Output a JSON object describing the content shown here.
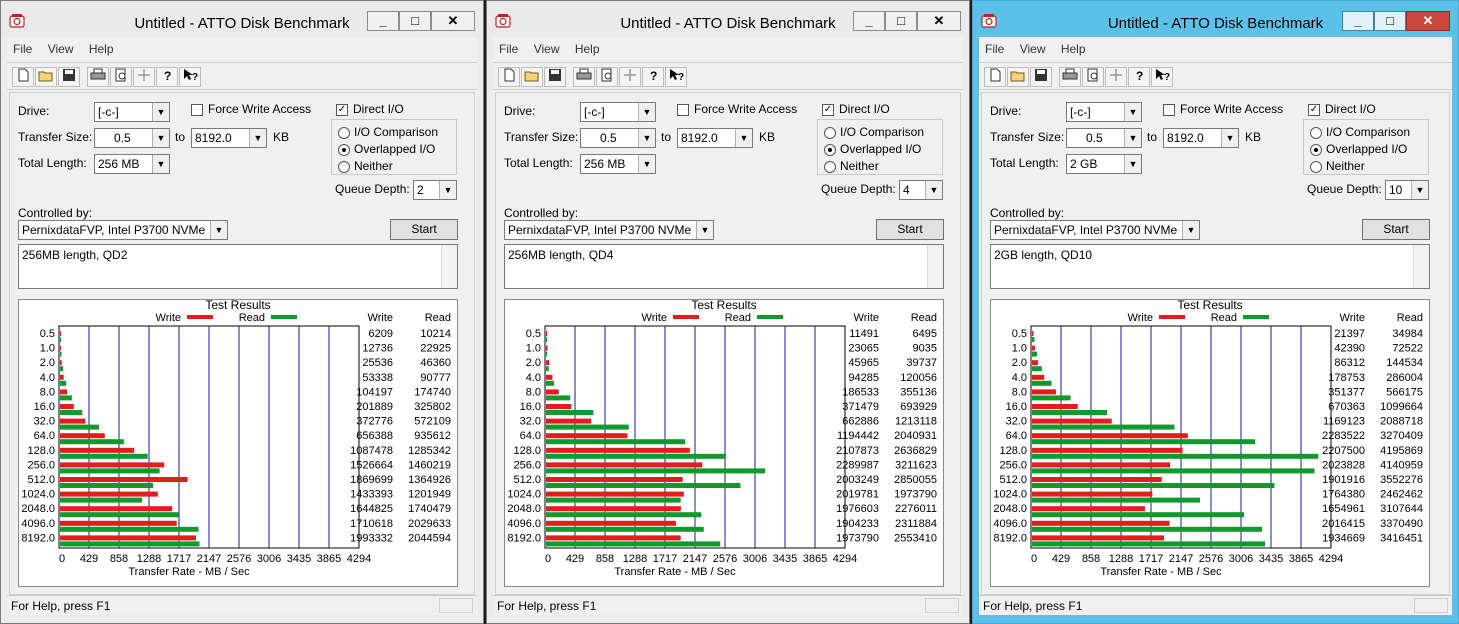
{
  "windows": [
    {
      "title": "Untitled - ATTO Disk Benchmark",
      "menu": [
        "File",
        "View",
        "Help"
      ],
      "drive_label": "Drive:",
      "drive": "[-c-]",
      "transfer_size_label": "Transfer Size:",
      "transfer_from": "0.5",
      "to_label": "to",
      "transfer_to": "8192.0",
      "kb_label": "KB",
      "total_length_label": "Total Length:",
      "total_length": "256 MB",
      "force_write_label": "Force Write Access",
      "direct_io_label": "Direct I/O",
      "direct_io_checked": true,
      "io_comparison_label": "I/O Comparison",
      "overlapped_io_label": "Overlapped I/O",
      "neither_label": "Neither",
      "queue_depth_label": "Queue Depth:",
      "queue_depth": "2",
      "controlled_by_label": "Controlled by:",
      "controlled_by": "PernixdataFVP, Intel P3700 NVMe",
      "start_label": "Start",
      "notes": "256MB length, QD2",
      "results_title": "Test Results",
      "legend_write": "Write",
      "legend_read": "Read",
      "col_write": "Write",
      "col_read": "Read",
      "status": "For Help, press F1",
      "chart_data": {
        "type": "bar",
        "xlabel": "Transfer Rate - MB / Sec",
        "xlim": [
          0,
          4294
        ],
        "xticks": [
          "0",
          "429",
          "858",
          "1288",
          "1717",
          "2147",
          "2576",
          "3006",
          "3435",
          "3865",
          "4294"
        ],
        "categories": [
          "0.5",
          "1.0",
          "2.0",
          "4.0",
          "8.0",
          "16.0",
          "32.0",
          "64.0",
          "128.0",
          "256.0",
          "512.0",
          "1024.0",
          "2048.0",
          "4096.0",
          "8192.0"
        ],
        "series": [
          {
            "name": "Write",
            "color": "#e51c1c",
            "values": [
              6209,
              12736,
              25536,
              53338,
              104197,
              201889,
              372776,
              656388,
              1087478,
              1526664,
              1869699,
              1433393,
              1644825,
              1710618,
              1993332
            ]
          },
          {
            "name": "Read",
            "color": "#119a2c",
            "values": [
              10214,
              22925,
              46360,
              90777,
              174740,
              325802,
              572109,
              935612,
              1285342,
              1460219,
              1364926,
              1201949,
              1740479,
              2029633,
              2044594
            ]
          }
        ]
      }
    },
    {
      "title": "Untitled - ATTO Disk Benchmark",
      "menu": [
        "File",
        "View",
        "Help"
      ],
      "drive_label": "Drive:",
      "drive": "[-c-]",
      "transfer_size_label": "Transfer Size:",
      "transfer_from": "0.5",
      "to_label": "to",
      "transfer_to": "8192.0",
      "kb_label": "KB",
      "total_length_label": "Total Length:",
      "total_length": "256 MB",
      "force_write_label": "Force Write Access",
      "direct_io_label": "Direct I/O",
      "direct_io_checked": true,
      "io_comparison_label": "I/O Comparison",
      "overlapped_io_label": "Overlapped I/O",
      "neither_label": "Neither",
      "queue_depth_label": "Queue Depth:",
      "queue_depth": "4",
      "controlled_by_label": "Controlled by:",
      "controlled_by": "PernixdataFVP, Intel P3700 NVMe",
      "start_label": "Start",
      "notes": "256MB length, QD4",
      "results_title": "Test Results",
      "legend_write": "Write",
      "legend_read": "Read",
      "col_write": "Write",
      "col_read": "Read",
      "status": "For Help, press F1",
      "chart_data": {
        "type": "bar",
        "xlabel": "Transfer Rate - MB / Sec",
        "xlim": [
          0,
          4294
        ],
        "xticks": [
          "0",
          "429",
          "858",
          "1288",
          "1717",
          "2147",
          "2576",
          "3006",
          "3435",
          "3865",
          "4294"
        ],
        "categories": [
          "0.5",
          "1.0",
          "2.0",
          "4.0",
          "8.0",
          "16.0",
          "32.0",
          "64.0",
          "128.0",
          "256.0",
          "512.0",
          "1024.0",
          "2048.0",
          "4096.0",
          "8192.0"
        ],
        "series": [
          {
            "name": "Write",
            "color": "#e51c1c",
            "values": [
              11491,
              23065,
              45965,
              94285,
              186533,
              371479,
              662886,
              1194442,
              2107873,
              2289987,
              2003249,
              2019781,
              1976603,
              1904233,
              1973790
            ]
          },
          {
            "name": "Read",
            "color": "#119a2c",
            "values": [
              6495,
              9035,
              39737,
              120056,
              355136,
              693929,
              1213118,
              2040931,
              2636829,
              3211623,
              2850055,
              1973790,
              2276011,
              2311884,
              2553410
            ]
          }
        ]
      }
    },
    {
      "title": "Untitled - ATTO Disk Benchmark",
      "menu": [
        "File",
        "View",
        "Help"
      ],
      "drive_label": "Drive:",
      "drive": "[-c-]",
      "transfer_size_label": "Transfer Size:",
      "transfer_from": "0.5",
      "to_label": "to",
      "transfer_to": "8192.0",
      "kb_label": "KB",
      "total_length_label": "Total Length:",
      "total_length": "2 GB",
      "force_write_label": "Force Write Access",
      "direct_io_label": "Direct I/O",
      "direct_io_checked": true,
      "io_comparison_label": "I/O Comparison",
      "overlapped_io_label": "Overlapped I/O",
      "neither_label": "Neither",
      "queue_depth_label": "Queue Depth:",
      "queue_depth": "10",
      "controlled_by_label": "Controlled by:",
      "controlled_by": "PernixdataFVP, Intel P3700 NVMe",
      "start_label": "Start",
      "notes": "2GB length, QD10",
      "results_title": "Test Results",
      "legend_write": "Write",
      "legend_read": "Read",
      "col_write": "Write",
      "col_read": "Read",
      "status": "For Help, press F1",
      "chart_data": {
        "type": "bar",
        "xlabel": "Transfer Rate - MB / Sec",
        "xlim": [
          0,
          4294
        ],
        "xticks": [
          "0",
          "429",
          "858",
          "1288",
          "1717",
          "2147",
          "2576",
          "3006",
          "3435",
          "3865",
          "4294"
        ],
        "categories": [
          "0.5",
          "1.0",
          "2.0",
          "4.0",
          "8.0",
          "16.0",
          "32.0",
          "64.0",
          "128.0",
          "256.0",
          "512.0",
          "1024.0",
          "2048.0",
          "4096.0",
          "8192.0"
        ],
        "series": [
          {
            "name": "Write",
            "color": "#e51c1c",
            "values": [
              21397,
              42390,
              86312,
              178753,
              351377,
              670363,
              1169123,
              2283522,
              2207500,
              2023828,
              1901916,
              1764380,
              1654961,
              2016415,
              1934669
            ]
          },
          {
            "name": "Read",
            "color": "#119a2c",
            "values": [
              34984,
              72522,
              144534,
              286004,
              566175,
              1099664,
              2088718,
              3270409,
              4195869,
              4140959,
              3552276,
              2462462,
              3107644,
              3370490,
              3416451
            ]
          }
        ]
      }
    }
  ]
}
